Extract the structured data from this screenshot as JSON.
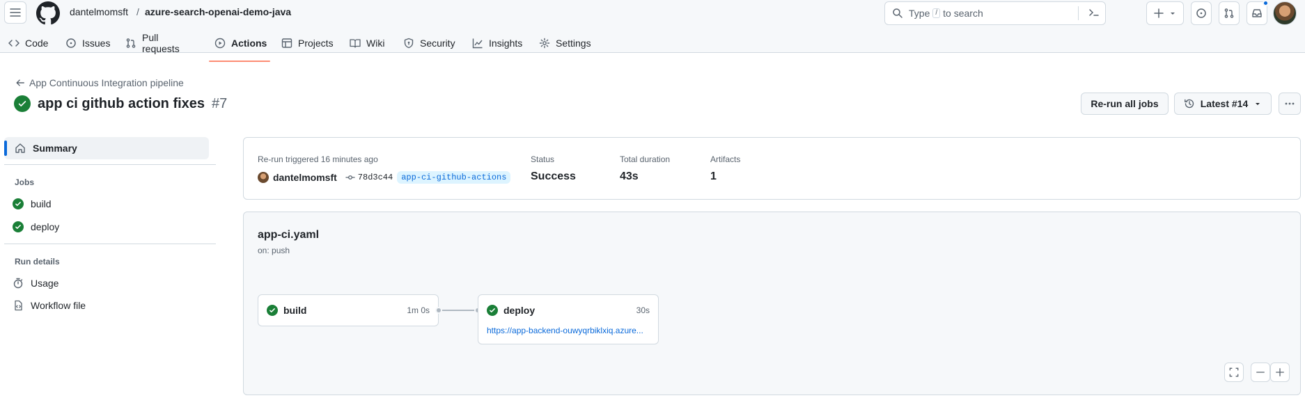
{
  "header": {
    "owner": "dantelmomsft",
    "separator": "/",
    "repo": "azure-search-openai-demo-java",
    "search_prefix": "Type",
    "search_key": "/",
    "search_suffix": "to search"
  },
  "nav": {
    "tabs": [
      {
        "label": "Code",
        "icon": "code-icon"
      },
      {
        "label": "Issues",
        "icon": "issue-icon"
      },
      {
        "label": "Pull requests",
        "icon": "pull-request-icon"
      },
      {
        "label": "Actions",
        "icon": "play-icon"
      },
      {
        "label": "Projects",
        "icon": "table-icon"
      },
      {
        "label": "Wiki",
        "icon": "book-icon"
      },
      {
        "label": "Security",
        "icon": "shield-icon"
      },
      {
        "label": "Insights",
        "icon": "graph-icon"
      },
      {
        "label": "Settings",
        "icon": "gear-icon"
      }
    ],
    "active": "Actions"
  },
  "run": {
    "workflow_link": "App Continuous Integration pipeline",
    "title": "app ci github action fixes",
    "number": "#7",
    "rerun_label": "Re-run all jobs",
    "latest_label": "Latest #14"
  },
  "sidebar": {
    "summary_label": "Summary",
    "jobs_heading": "Jobs",
    "jobs": [
      {
        "label": "build",
        "status": "success"
      },
      {
        "label": "deploy",
        "status": "success"
      }
    ],
    "details_heading": "Run details",
    "details": [
      {
        "label": "Usage",
        "icon": "stopwatch-icon"
      },
      {
        "label": "Workflow file",
        "icon": "file-code-icon"
      }
    ]
  },
  "summary": {
    "trigger_text": "Re-run triggered 16 minutes ago",
    "actor": "dantelmomsft",
    "commit_sha": "78d3c44",
    "branch": "app-ci-github-actions",
    "status_label": "Status",
    "status_value": "Success",
    "duration_label": "Total duration",
    "duration_value": "43s",
    "artifacts_label": "Artifacts",
    "artifacts_value": "1"
  },
  "workflow": {
    "file": "app-ci.yaml",
    "trigger": "on: push",
    "jobs": [
      {
        "name": "build",
        "duration": "1m 0s"
      },
      {
        "name": "deploy",
        "duration": "30s",
        "url": "https://app-backend-ouwyqrbiklxiq.azure..."
      }
    ]
  },
  "colors": {
    "success": "#1a7f37",
    "link": "#0969da",
    "active_tab_underline": "#fd8c73"
  }
}
